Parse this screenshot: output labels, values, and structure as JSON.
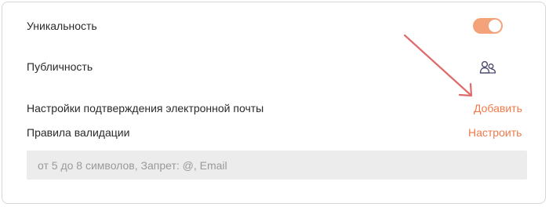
{
  "settings": {
    "uniqueness_label": "Уникальность",
    "uniqueness_enabled": true,
    "publicity_label": "Публичность",
    "email_confirmation_label": "Настройки подтверждения электронной почты",
    "email_confirmation_action": "Добавить",
    "validation_rules_label": "Правила валидации",
    "validation_rules_action": "Настроить",
    "validation_rules_summary": "от 5 до 8 символов, Запрет: @, Email"
  },
  "icons": {
    "publicity_icon": "users-icon",
    "annotation": "arrow-annotation-icon"
  },
  "colors": {
    "accent": "#f07a4a",
    "toggle_on": "#f4a27a",
    "annotation_arrow": "#e06b6b"
  }
}
